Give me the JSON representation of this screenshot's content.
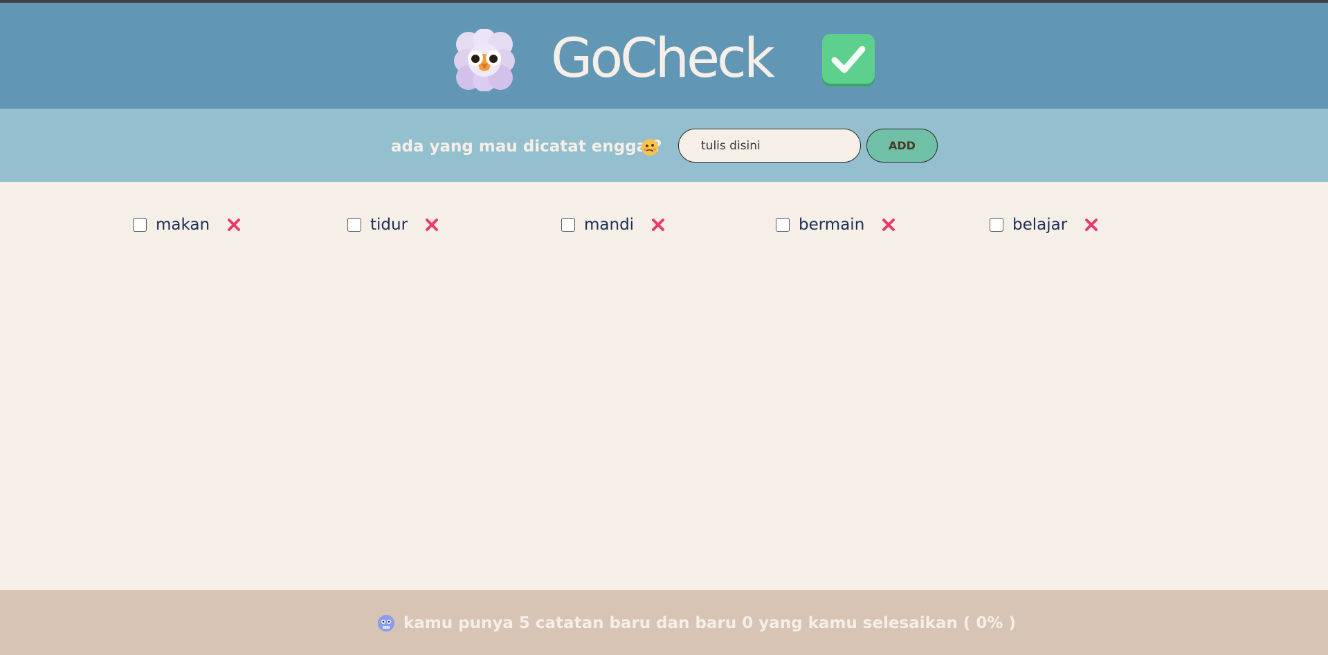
{
  "header": {
    "brand": "GoCheck",
    "mascot_icon": "fluffy-owl-icon",
    "badge_icon": "check-mark-button-icon"
  },
  "input_bar": {
    "prompt": "ada yang mau dicatat engga ?",
    "prompt_emoji": "woozy-face-icon",
    "placeholder": "tulis disini",
    "add_label": "ADD"
  },
  "todos": [
    {
      "label": "makan",
      "checked": false
    },
    {
      "label": "tidur",
      "checked": false
    },
    {
      "label": "mandi",
      "checked": false
    },
    {
      "label": "bermain",
      "checked": false
    },
    {
      "label": "belajar",
      "checked": false
    }
  ],
  "footer": {
    "emoji": "cold-face-icon",
    "summary": "kamu punya 5 catatan baru dan baru 0 yang kamu selesaikan ( 0% )"
  },
  "colors": {
    "header_bg": "#6196b5",
    "input_bar_bg": "#94bfce",
    "page_bg": "#f6efe8",
    "footer_bg": "#d7c4b5",
    "add_button": "#6fc0a7",
    "delete_icon": "#e8386d"
  }
}
